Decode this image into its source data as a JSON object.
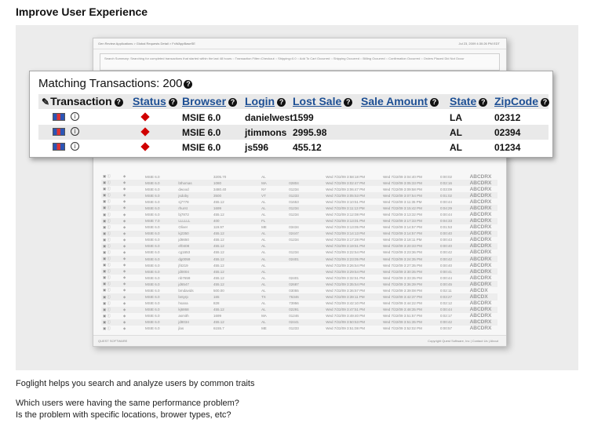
{
  "page": {
    "heading": "Improve User Experience",
    "caption1": "Foglight helps you search and analyze users by common traits",
    "caption2": "Which users were having the same performance problem?",
    "caption3": "Is the problem with specific locations, brower types, etc?"
  },
  "background_window": {
    "breadcrumb": "Gen Review Applications > Global Requests Detail > FxWAppBaseSE",
    "timestamp": "Jul 23, 2009 4:30:26 PM EDT",
    "summary": "Search Summary: Searching for completed transactions that started within the last 48 hours :: Transaction Filter=Checkout :: Shipping=0.0 :: Add To Cart Occurred :: Shipping Occurred :: Billing Occurred :: Confirmation Occurred :: Orders Placed Did Not Occur",
    "footer_left": "QUEST SOFTWARE",
    "footer_right": "Copyright Quest Software, Inc | Contact Us | About",
    "rows": [
      {
        "browser": "MSIE 6.0",
        "login": "",
        "amount": "3205.70",
        "state": "AL",
        "zip": "",
        "start": "Wed 7/22/09 3:58:18 PM",
        "end": "Wed 7/22/09 3:04:40 PM",
        "dur": "0:00:02",
        "code": "ABCDRX"
      },
      {
        "browser": "MSIE 6.0",
        "login": "bthomas",
        "amount": "1080",
        "state": "MA",
        "zip": "02804",
        "start": "Wed 7/22/09 3:02:47 PM",
        "end": "Wed 7/22/09 3:05:33 PM",
        "dur": "0:02:16",
        "code": "ABCDRX"
      },
      {
        "browser": "MSIE 6.0",
        "login": "dwood",
        "amount": "3480.40",
        "state": "NY",
        "zip": "01234",
        "start": "Wed 7/22/09 3:06:47 PM",
        "end": "Wed 7/22/09 3:09:58 PM",
        "dur": "0:03:09",
        "code": "ABCDRX"
      },
      {
        "browser": "MSIE 6.0",
        "login": "jsdoby",
        "amount": "3500",
        "state": "VT",
        "zip": "01233",
        "start": "Wed 7/22/09 3:05:53 PM",
        "end": "Wed 7/22/09 3:07:54 PM",
        "dur": "0:01:02",
        "code": "ABCDRX"
      },
      {
        "browser": "MSIE 6.0",
        "login": "sj7778",
        "amount": "455.12",
        "state": "AL",
        "zip": "01653",
        "start": "Wed 7/22/09 3:10:51 PM",
        "end": "Wed 7/22/09 3:11:35 PM",
        "dur": "0:00:44",
        "code": "ABCDRX"
      },
      {
        "browser": "MSIE 6.0",
        "login": "rhurst",
        "amount": "1699",
        "state": "AL",
        "zip": "01234",
        "start": "Wed 7/22/09 3:11:13 PM",
        "end": "Wed 7/22/09 3:15:42 PM",
        "dur": "0:04:29",
        "code": "ABCDRX"
      },
      {
        "browser": "MSIE 6.0",
        "login": "bj7872",
        "amount": "455.12",
        "state": "AL",
        "zip": "01234",
        "start": "Wed 7/22/09 3:12:08 PM",
        "end": "Wed 7/22/09 3:13:32 PM",
        "dur": "0:00:44",
        "code": "ABCDRX"
      },
      {
        "browser": "MSIE 7.0",
        "login": "LLLLLL",
        "amount": "400",
        "state": "FL",
        "zip": "",
        "start": "Wed 7/22/09 3:13:01 PM",
        "end": "Wed 7/22/09 3:17:33 PM",
        "dur": "0:04:33",
        "code": "ABCDRX"
      },
      {
        "browser": "MSIE 6.0",
        "login": "Oliver",
        "amount": "119.97",
        "state": "ME",
        "zip": "03434",
        "start": "Wed 7/22/09 3:13:05 PM",
        "end": "Wed 7/22/09 3:14:57 PM",
        "dur": "0:01:53",
        "code": "ABCDRX"
      },
      {
        "browser": "MSIE 6.0",
        "login": "kj2350",
        "amount": "455.12",
        "state": "AL",
        "zip": "02447",
        "start": "Wed 7/22/09 3:14:13 PM",
        "end": "Wed 7/22/09 3:14:57 PM",
        "dur": "0:00:40",
        "code": "ABCDRX"
      },
      {
        "browser": "MSIE 6.0",
        "login": "jd6650",
        "amount": "455.12",
        "state": "AL",
        "zip": "01234",
        "start": "Wed 7/22/09 3:17:28 PM",
        "end": "Wed 7/22/09 3:18:11 PM",
        "dur": "0:00:43",
        "code": "ABCDRX"
      },
      {
        "browser": "MSIE 6.0",
        "login": "ef0408",
        "amount": "455.12",
        "state": "AL",
        "zip": "",
        "start": "Wed 7/22/09 3:19:51 PM",
        "end": "Wed 7/22/09 3:20:33 PM",
        "dur": "0:00:40",
        "code": "ABCDRX"
      },
      {
        "browser": "MSIE 6.0",
        "login": "cg1653",
        "amount": "455.12",
        "state": "AL",
        "zip": "01234",
        "start": "Wed 7/22/09 3:22:54 PM",
        "end": "Wed 7/22/09 3:23:36 PM",
        "dur": "0:00:42",
        "code": "ABCDRX"
      },
      {
        "browser": "MSIE 6.0",
        "login": "dg0059",
        "amount": "455.12",
        "state": "AL",
        "zip": "02401",
        "start": "Wed 7/22/09 3:23:05 PM",
        "end": "Wed 7/22/09 3:24:35 PM",
        "dur": "0:00:42",
        "code": "ABCDRX"
      },
      {
        "browser": "MSIE 6.0",
        "login": "jf4219",
        "amount": "455.12",
        "state": "AL",
        "zip": "",
        "start": "Wed 7/22/09 3:26:54 PM",
        "end": "Wed 7/22/09 3:27:35 PM",
        "dur": "0:00:40",
        "code": "ABCDRX"
      },
      {
        "browser": "MSIE 6.0",
        "login": "jd0004",
        "amount": "455.12",
        "state": "AL",
        "zip": "",
        "start": "Wed 7/22/09 3:29:54 PM",
        "end": "Wed 7/22/09 3:30:35 PM",
        "dur": "0:00:41",
        "code": "ABCDRX"
      },
      {
        "browser": "MSIE 6.0",
        "login": "nb7659",
        "amount": "455.12",
        "state": "AL",
        "zip": "02401",
        "start": "Wed 7/22/09 3:32:51 PM",
        "end": "Wed 7/22/09 3:33:35 PM",
        "dur": "0:00:44",
        "code": "ABCDRX"
      },
      {
        "browser": "MSIE 6.0",
        "login": "jd6547",
        "amount": "455.12",
        "state": "AL",
        "zip": "02687",
        "start": "Wed 7/22/09 3:35:54 PM",
        "end": "Wed 7/22/09 3:36:39 PM",
        "dur": "0:00:45",
        "code": "ABCDRX"
      },
      {
        "browser": "MSIE 6.0",
        "login": "bmdavids",
        "amount": "500.00",
        "state": "AL",
        "zip": "03055",
        "start": "Wed 7/22/09 3:36:57 PM",
        "end": "Wed 7/22/09 3:39:08 PM",
        "dur": "0:02:11",
        "code": "ABCDX"
      },
      {
        "browser": "MSIE 6.0",
        "login": "bntyrp",
        "amount": "165",
        "state": "TX",
        "zip": "76346",
        "start": "Wed 7/22/09 3:39:11 PM",
        "end": "Wed 7/22/09 3:42:37 PM",
        "dur": "0:03:27",
        "code": "ABCDX"
      },
      {
        "browser": "MSIE 6.0",
        "login": "hsana",
        "amount": "828",
        "state": "AL",
        "zip": "73956",
        "start": "Wed 7/22/09 3:42:10 PM",
        "end": "Wed 7/22/09 3:44:22 PM",
        "dur": "0:02:12",
        "code": "ABCDRX"
      },
      {
        "browser": "MSIE 6.0",
        "login": "kj6868",
        "amount": "455.12",
        "state": "AL",
        "zip": "02291",
        "start": "Wed 7/22/09 3:47:51 PM",
        "end": "Wed 7/22/09 3:48:35 PM",
        "dur": "0:00:44",
        "code": "ABCDRX"
      },
      {
        "browser": "MSIE 6.0",
        "login": "asmith",
        "amount": "1699",
        "state": "MA",
        "zip": "01246",
        "start": "Wed 7/22/09 3:49:40 PM",
        "end": "Wed 7/22/09 3:51:57 PM",
        "dur": "0:02:17",
        "code": "ABCDRX"
      },
      {
        "browser": "MSIE 6.0",
        "login": "jd8034",
        "amount": "455.12",
        "state": "AL",
        "zip": "02441",
        "start": "Wed 7/22/09 3:50:53 PM",
        "end": "Wed 7/22/09 3:51:35 PM",
        "dur": "0:00:42",
        "code": "ABCDRX"
      },
      {
        "browser": "MSIE 6.0",
        "login": "jlas",
        "amount": "6155.7",
        "state": "ME",
        "zip": "01233",
        "start": "Wed 7/22/09 3:51:08 PM",
        "end": "Wed 7/22/09 3:52:02 PM",
        "dur": "0:00:57",
        "code": "ABCDRX"
      }
    ]
  },
  "zoom_panel": {
    "title": "Matching Transactions: 200",
    "help_glyph": "?",
    "columns": {
      "transaction": "Transaction",
      "status": "Status",
      "browser": "Browser",
      "login": "Login",
      "lost_sale": "Lost Sale",
      "sale_amount": "Sale Amount",
      "state": "State",
      "zipcode": "ZipCode"
    },
    "status_color": "#d00000",
    "link_color": "#1d4f94",
    "rows": [
      {
        "browser": "MSIE 6.0",
        "login": "danielwest",
        "lost_sale": "1599",
        "state": "LA",
        "zip": "02312"
      },
      {
        "browser": "MSIE 6.0",
        "login": "jtimmons",
        "lost_sale": "2995.98",
        "state": "AL",
        "zip": "02394"
      },
      {
        "browser": "MSIE 6.0",
        "login": "js596",
        "lost_sale": "455.12",
        "state": "AL",
        "zip": "01234"
      }
    ]
  }
}
